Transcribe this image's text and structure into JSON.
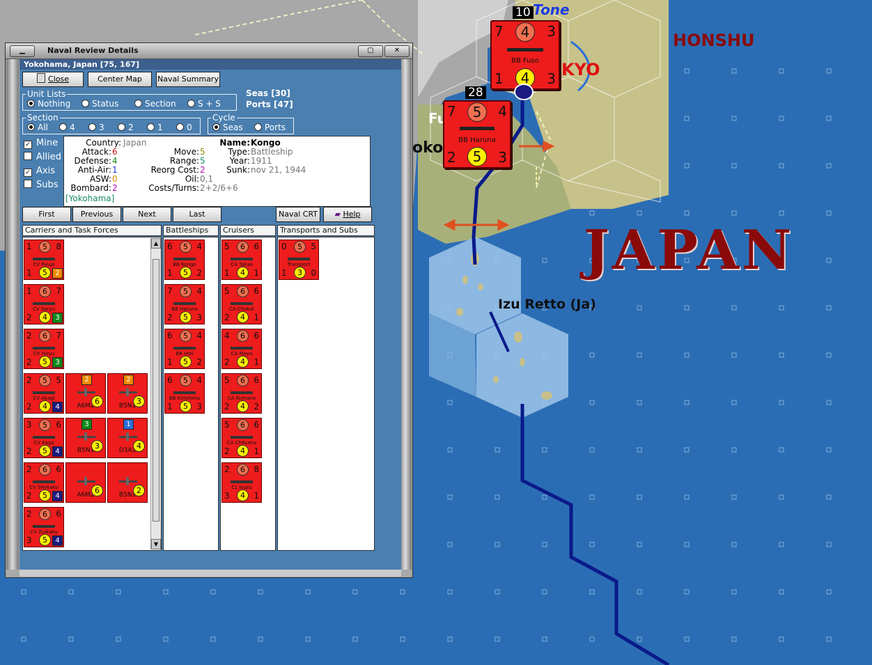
{
  "map": {
    "labels": {
      "honshu": "HONSHU",
      "japan": "JAPAN",
      "izu": "Izu Retto (Ja)",
      "tone": "Tone",
      "tokyo": "KYO",
      "yokohama_partial": "oko",
      "fu_partial": "Fu"
    },
    "stacks": [
      {
        "badge": "10",
        "attack": "7",
        "top": "4",
        "range": "3",
        "name": "BB Fuso",
        "defense": "1",
        "bottom": "4",
        "sunk": "3"
      },
      {
        "badge": "28",
        "attack": "7",
        "top": "5",
        "range": "4",
        "name": "BB Haruna",
        "defense": "2",
        "bottom": "5",
        "sunk": "3"
      }
    ]
  },
  "window": {
    "title": "Naval Review Details",
    "location": "Yokohama, Japan [75, 167]",
    "buttons": {
      "close": "Close",
      "center": "Center Map",
      "summary": "Naval Summary"
    },
    "unit_lists": {
      "label": "Unit Lists",
      "options": [
        "Nothing",
        "Status",
        "Section",
        "S + S"
      ],
      "selected": "Nothing"
    },
    "seas": "Seas [30]",
    "ports": "Ports [47]",
    "section": {
      "label": "Section",
      "options": [
        "All",
        "4",
        "3",
        "2",
        "1",
        "0"
      ],
      "selected": "All"
    },
    "cycle": {
      "label": "Cycle",
      "options": [
        "Seas",
        "Ports"
      ],
      "selected": "Seas"
    },
    "filters": [
      {
        "label": "Mine",
        "checked": true
      },
      {
        "label": "Allied",
        "checked": false
      },
      {
        "label": "Axis",
        "checked": true
      },
      {
        "label": "Subs",
        "checked": false
      }
    ],
    "info": {
      "country_k": "Country:",
      "country": "Japan",
      "attack_k": "Attack:",
      "attack": "6",
      "defense_k": "Defense:",
      "defense": "4",
      "antiair_k": "Anti-Air:",
      "antiair": "1",
      "asw_k": "ASW:",
      "asw": "0",
      "bombard_k": "Bombard:",
      "bombard": "2",
      "base": "[Yokohama]",
      "move_k": "Move:",
      "move": "5",
      "range_k": "Range:",
      "range": "5",
      "reorg_k": "Reorg Cost:",
      "reorg": "2",
      "oil_k": "Oil:",
      "oil": "0,1",
      "costs_k": "Costs/Turns:",
      "costs": "2+2/6+6",
      "name_k": "Name:",
      "name": "Kongo",
      "type_k": "Type:",
      "type": "Battleship",
      "year_k": "Year:",
      "year": "1911",
      "sunk_k": "Sunk:",
      "sunk": "nov 21, 1944"
    },
    "nav": {
      "first": "First",
      "previous": "Previous",
      "next": "Next",
      "last": "Last",
      "crt": "Naval CRT",
      "help": "Help"
    },
    "columns": [
      "Carriers and Task Forces",
      "Battleships",
      "Cruisers",
      "Transports and Subs"
    ],
    "carriers": [
      {
        "a": "1",
        "m": "5",
        "c": "8",
        "name": "CV Ryujo",
        "d": "1",
        "y": "5",
        "sq": "2",
        "sqc": "#f08a00"
      },
      {
        "a": "1",
        "m": "6",
        "c": "7",
        "name": "CV Soryu",
        "d": "2",
        "y": "4",
        "sq": "3",
        "sqc": "#0b8a1a"
      },
      {
        "a": "2",
        "m": "6",
        "c": "7",
        "name": "CV Hiryu",
        "d": "2",
        "y": "5",
        "sq": "3",
        "sqc": "#0b8a1a"
      },
      {
        "a": "2",
        "m": "5",
        "c": "5",
        "name": "CV Akagi",
        "d": "2",
        "y": "4",
        "sq": "4",
        "sqc": "#1a1a80"
      },
      {
        "a": "3",
        "m": "5",
        "c": "6",
        "name": "CV Kaga",
        "d": "2",
        "y": "5",
        "sq": "4",
        "sqc": "#1a1a80"
      },
      {
        "a": "2",
        "m": "6",
        "c": "6",
        "name": "CV Shokaku",
        "d": "2",
        "y": "5",
        "sq": "4",
        "sqc": "#1a1a80"
      },
      {
        "a": "2",
        "m": "6",
        "c": "6",
        "name": "CV Zuikaku",
        "d": "3",
        "y": "5",
        "sq": "4",
        "sqc": "#1a1a80"
      }
    ],
    "planes": [
      {
        "top": "2",
        "topc": "#f08a00",
        "name": "A6M2",
        "y": "6"
      },
      {
        "top": "2",
        "topc": "#f08a00",
        "name": "B5N1",
        "y": "3"
      },
      {
        "top": "3",
        "topc": "#0b8a1a",
        "name": "B5N1",
        "y": "3"
      },
      {
        "top": "1",
        "topc": "#2a6fd8",
        "name": "D3A1",
        "y": "4"
      },
      {
        "top": "",
        "topc": "",
        "name": "A6M2",
        "y": "6"
      },
      {
        "top": "",
        "topc": "",
        "name": "B5N1",
        "y": "2"
      }
    ],
    "battleships": [
      {
        "a": "6",
        "m": "5",
        "c": "4",
        "name": "BB Kongo",
        "d": "1",
        "y": "5",
        "e": "2"
      },
      {
        "a": "7",
        "m": "5",
        "c": "4",
        "name": "BB Haruna",
        "d": "2",
        "y": "5",
        "e": "3"
      },
      {
        "a": "6",
        "m": "5",
        "c": "4",
        "name": "BB Hiei",
        "d": "1",
        "y": "5",
        "e": "2"
      },
      {
        "a": "6",
        "m": "5",
        "c": "4",
        "name": "BB Kirishima",
        "d": "1",
        "y": "5",
        "e": "3"
      }
    ],
    "cruisers": [
      {
        "a": "5",
        "m": "6",
        "c": "6",
        "name": "CA Takao",
        "d": "1",
        "y": "4",
        "e": "1"
      },
      {
        "a": "5",
        "m": "6",
        "c": "6",
        "name": "CA Chokai",
        "d": "2",
        "y": "4",
        "e": "1"
      },
      {
        "a": "4",
        "m": "6",
        "c": "6",
        "name": "CA Maya",
        "d": "2",
        "y": "4",
        "e": "1"
      },
      {
        "a": "5",
        "m": "6",
        "c": "6",
        "name": "CA Kumano",
        "d": "2",
        "y": "4",
        "e": "2"
      },
      {
        "a": "5",
        "m": "6",
        "c": "6",
        "name": "CA Chikuma",
        "d": "2",
        "y": "4",
        "e": "1"
      },
      {
        "a": "2",
        "m": "6",
        "c": "8",
        "name": "CL Isuzu",
        "d": "3",
        "y": "4",
        "e": "1"
      }
    ],
    "transports": [
      {
        "a": "0",
        "m": "5",
        "c": "5",
        "name": "Transport",
        "d": "1",
        "y": "3",
        "e": "0"
      }
    ]
  }
}
